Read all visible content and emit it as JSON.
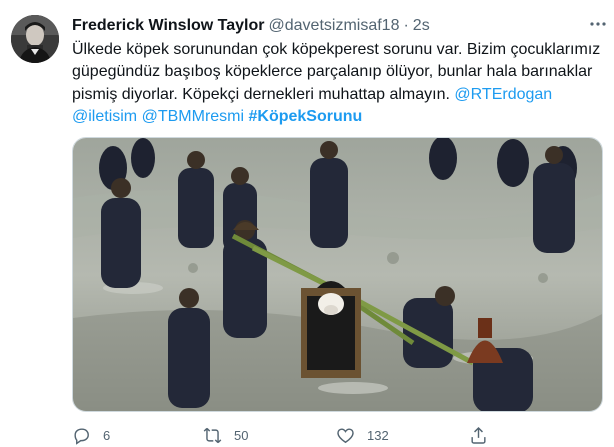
{
  "tweet": {
    "author": {
      "name": "Frederick Winslow Taylor",
      "handle": "@davetsizmisaf18",
      "separator": "·",
      "time": "2s"
    },
    "text": {
      "part1": "Ülkede köpek sorunundan çok köpekperest sorunu var. Bizim çocuklarımız güpegündüz başıboş köpeklerce parçalanıp ölüyor, bunlar hala barınaklar pismiş diyorlar. Köpekçi dernekleri muhattap almayın.",
      "mention1": "@RTErdogan",
      "mention2": "@iletisim",
      "mention3": "@TBMMresmi",
      "hashtag": "#KöpekSorunu"
    },
    "media": {
      "icon": "photo"
    },
    "actions": {
      "reply": {
        "icon": "reply-icon",
        "count": "6"
      },
      "retweet": {
        "icon": "retweet-icon",
        "count": "50"
      },
      "like": {
        "icon": "like-icon",
        "count": "132"
      },
      "share": {
        "icon": "share-icon"
      }
    },
    "colors": {
      "link": "#1d9bf0",
      "secondary": "#536471",
      "text": "#0f1419"
    }
  }
}
